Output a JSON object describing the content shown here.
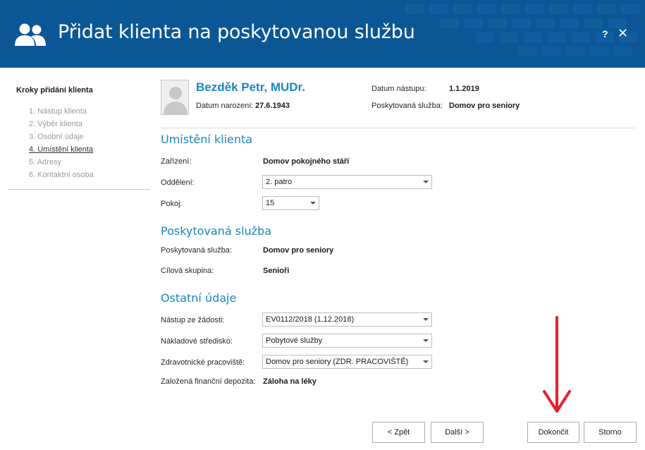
{
  "window": {
    "title": "Přidat klienta na poskytovanou službu",
    "help_label": "?",
    "close_label": "✕",
    "icon": "users-icon"
  },
  "sidebar": {
    "title": "Kroky přidání klienta",
    "steps": [
      "1. Nástup klienta",
      "2. Výběr klienta",
      "3. Osobní údaje",
      "4. Umístění klienta",
      "5. Adresy",
      "6. Kontaktní osoba"
    ],
    "active_step": 3
  },
  "client": {
    "name": "Bezděk Petr, MUDr.",
    "birth_label": "Datum narození:",
    "birth_value": "27.6.1943",
    "start_label": "Datum nástupu:",
    "start_value": "1.1.2019",
    "service_label": "Poskytovaná služba:",
    "service_value": "Domov pro seniory"
  },
  "placement": {
    "title": "Umístění klienta",
    "facility_label": "Zařízení:",
    "facility_value": "Domov pokojného stáří",
    "department_label": "Oddělení:",
    "department_value": "2. patro",
    "room_label": "Pokoj:",
    "room_value": "15"
  },
  "service": {
    "title": "Poskytovaná služba",
    "service_label": "Poskytovaná služba:",
    "service_value": "Domov pro seniory",
    "target_label": "Cílová skupina:",
    "target_value": "Senioři"
  },
  "other": {
    "title": "Ostatní údaje",
    "request_label": "Nástup ze žádosti:",
    "request_value": "EV0112/2018 (1.12.2018)",
    "cost_label": "Nákladové středisko:",
    "cost_value": "Pobytové služby",
    "health_label": "Zdravotnické pracoviště:",
    "health_value": "Domov pro seniory (ZDR. PRACOVIŠTĚ)",
    "deposit_label": "Založená finanční depozita:",
    "deposit_value": "Záloha na léky"
  },
  "buttons": {
    "back": "< Zpět",
    "next": "Další >",
    "finish": "Dokončit",
    "cancel": "Storno"
  },
  "colors": {
    "header_bg": "#0b5796",
    "accent": "#1a87c8",
    "annotation": "#e8202a"
  }
}
